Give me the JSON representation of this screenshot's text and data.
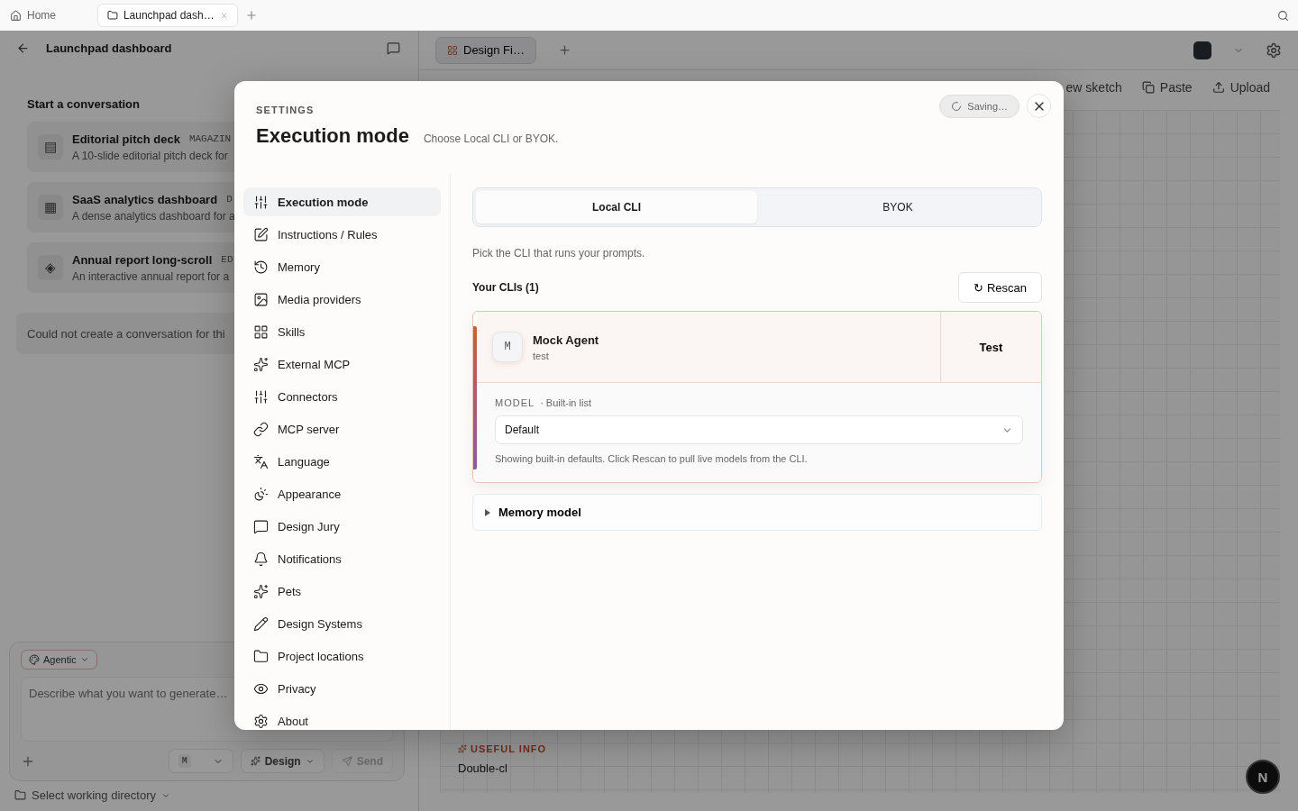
{
  "browser_tabs": [
    {
      "label": "Home",
      "kind": "home",
      "selected": false
    },
    {
      "label": "Launchpad dash…",
      "kind": "folder",
      "selected": true
    }
  ],
  "left_panel": {
    "title": "Launchpad dashboard",
    "section_title": "Start a conversation",
    "templates": [
      {
        "glyph": "▤",
        "title": "Editorial pitch deck",
        "tag": "MAGAZIN",
        "description": "A 10-slide editorial pitch deck for"
      },
      {
        "glyph": "▦",
        "title": "SaaS analytics dashboard",
        "tag": "D",
        "description": "A dense analytics dashboard for a"
      },
      {
        "glyph": "◈",
        "title": "Annual report long-scroll",
        "tag": "ED",
        "description": "An interactive annual report for a"
      }
    ],
    "error": "Could not create a conversation for thi",
    "composer": {
      "mode": "Agentic",
      "placeholder": "Describe what you want to generate…",
      "model_badge": "M",
      "design": "Design",
      "send": "Send",
      "send_disabled": true
    },
    "working_directory": "Select working directory"
  },
  "right_panel": {
    "tabs": [
      {
        "label": "Design Fi…",
        "selected": true
      }
    ],
    "toolbar": [
      {
        "label": "ew sketch",
        "kind": "sketch"
      },
      {
        "label": "Paste",
        "kind": "paste"
      },
      {
        "label": "Upload",
        "kind": "upload"
      }
    ],
    "useful_info": {
      "heading": "USEFUL INFO",
      "text": "Double-cl"
    },
    "assistant_badge": "N"
  },
  "settings": {
    "eyebrow": "SETTINGS",
    "title": "Execution mode",
    "subtitle": "Choose Local CLI or BYOK.",
    "status": "Saving…",
    "nav": [
      {
        "label": "Execution mode",
        "selected": true
      },
      {
        "label": "Instructions / Rules",
        "selected": false
      },
      {
        "label": "Memory",
        "selected": false
      },
      {
        "label": "Media providers",
        "selected": false
      },
      {
        "label": "Skills",
        "selected": false
      },
      {
        "label": "External MCP",
        "selected": false
      },
      {
        "label": "Connectors",
        "selected": false
      },
      {
        "label": "MCP server",
        "selected": false
      },
      {
        "label": "Language",
        "selected": false
      },
      {
        "label": "Appearance",
        "selected": false
      },
      {
        "label": "Design Jury",
        "selected": false
      },
      {
        "label": "Notifications",
        "selected": false
      },
      {
        "label": "Pets",
        "selected": false
      },
      {
        "label": "Design Systems",
        "selected": false
      },
      {
        "label": "Project locations",
        "selected": false
      },
      {
        "label": "Privacy",
        "selected": false
      },
      {
        "label": "About",
        "selected": false
      }
    ],
    "mode_tabs": [
      {
        "label": "Local CLI",
        "selected": true
      },
      {
        "label": "BYOK",
        "selected": false
      }
    ],
    "hint": "Pick the CLI that runs your prompts.",
    "clis_heading": "Your CLIs (1)",
    "rescan": "↻ Rescan",
    "clis": [
      {
        "avatar": "M",
        "name": "Mock Agent",
        "subtitle": "test",
        "action": "Test",
        "selected": true,
        "model_label": "MODEL",
        "model_source": "· Built-in list",
        "model_value": "Default",
        "help": "Showing built-in defaults. Click Rescan to pull live models from the CLI."
      }
    ],
    "memory_model": {
      "label": "Memory model",
      "expanded": false
    }
  }
}
